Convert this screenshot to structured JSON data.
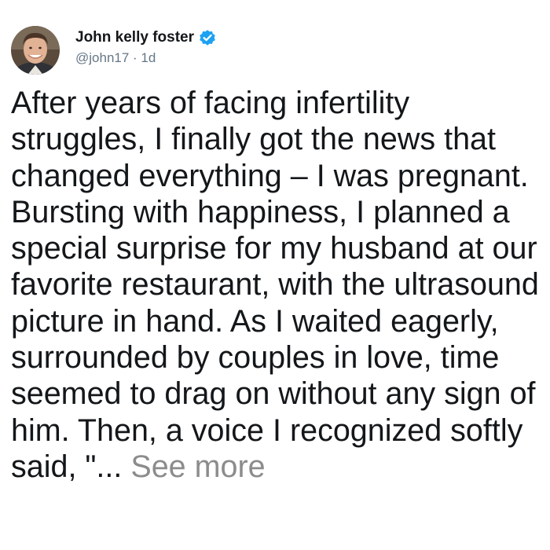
{
  "tweet": {
    "author": {
      "display_name": "John kelly foster",
      "handle": "@john17",
      "verified": true,
      "avatar_icon": "profile-photo"
    },
    "separator": " · ",
    "age": "1d",
    "text": "After years of facing infertility struggles, I finally got the news that changed everything – I was pregnant. Bursting with happiness, I planned a special surprise for my husband at our favorite restaurant, with the ultrasound picture in hand. As I waited eagerly, surrounded by couples in love, time seemed to drag on without any sign of him. Then, a voice I recognized softly said, \"...",
    "see_more_label": "See more"
  },
  "colors": {
    "text_primary": "#14171a",
    "text_secondary": "#657786",
    "verified_blue": "#1da1f2",
    "see_more_gray": "#8c8c8c"
  }
}
